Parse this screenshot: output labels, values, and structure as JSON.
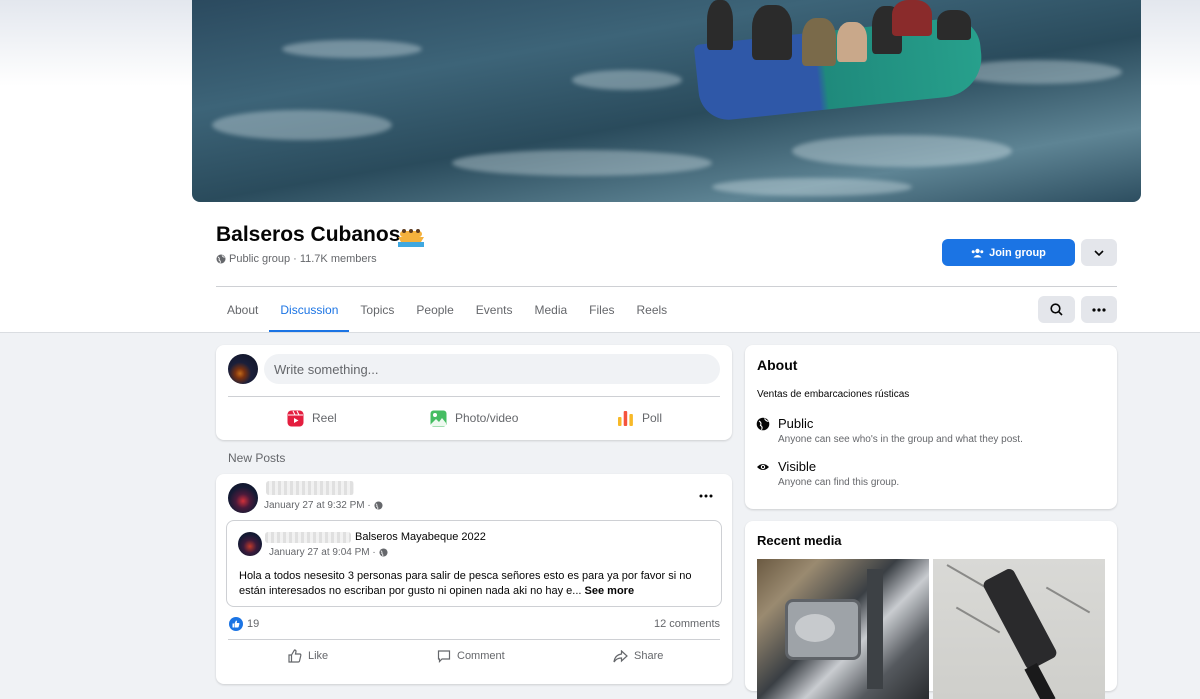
{
  "group": {
    "name": "Balseros Cubanos",
    "privacy": "Public group",
    "separator": "·",
    "members": "11.7K members"
  },
  "header_buttons": {
    "join_label": "Join group",
    "more_icon": "chevron-down-icon",
    "search_icon": "search-icon",
    "options_icon": "more-horizontal-icon"
  },
  "tabs": [
    {
      "label": "About",
      "active": false
    },
    {
      "label": "Discussion",
      "active": true
    },
    {
      "label": "Topics",
      "active": false
    },
    {
      "label": "People",
      "active": false
    },
    {
      "label": "Events",
      "active": false
    },
    {
      "label": "Media",
      "active": false
    },
    {
      "label": "Files",
      "active": false
    },
    {
      "label": "Reels",
      "active": false
    }
  ],
  "composer": {
    "placeholder": "Write something...",
    "actions": [
      {
        "label": "Reel",
        "icon": "reel-icon",
        "color": "#e41e3f"
      },
      {
        "label": "Photo/video",
        "icon": "photo-icon",
        "color": "#45bd62"
      },
      {
        "label": "Poll",
        "icon": "poll-icon",
        "color": "#f7b928"
      }
    ]
  },
  "feed": {
    "section_label": "New Posts"
  },
  "post": {
    "timestamp": "January 27 at 9:32 PM ·",
    "shared": {
      "group_name": "Balseros Mayabeque 2022",
      "timestamp": "January 27 at 9:04 PM ·",
      "text": "Hola a todos nesesito 3 personas para salir de pesca señores esto es para ya por favor si no están interesados no escriban por gusto ni opinen nada aki no hay e...",
      "see_more": "See more"
    },
    "reactions_count": "19",
    "comments_count": "12 comments",
    "actions": {
      "like": "Like",
      "comment": "Comment",
      "share": "Share"
    }
  },
  "about": {
    "title": "About",
    "description": "Ventas de embarcaciones rústicas",
    "public_title": "Public",
    "public_desc": "Anyone can see who's in the group and what they post.",
    "visible_title": "Visible",
    "visible_desc": "Anyone can find this group."
  },
  "recent_media": {
    "title": "Recent media"
  },
  "colors": {
    "accent": "#1b74e4",
    "background": "#f0f2f5",
    "secondary_text": "#65676b"
  }
}
